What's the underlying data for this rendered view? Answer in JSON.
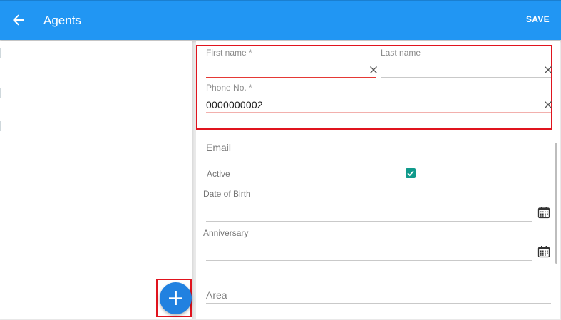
{
  "appbar": {
    "title": "Agents",
    "save_label": "SAVE",
    "colors": {
      "background": "#2196f3",
      "text": "#ffffff"
    },
    "back_icon": "arrow-back-icon"
  },
  "form": {
    "first_name": {
      "label": "First name *",
      "value": ""
    },
    "last_name": {
      "label": "Last name",
      "value": ""
    },
    "phone": {
      "label": "Phone No. *",
      "value": "0000000002"
    },
    "email": {
      "placeholder": "Email"
    },
    "active": {
      "label": "Active",
      "checked": true
    },
    "dob": {
      "label": "Date of Birth",
      "value": ""
    },
    "anniversary": {
      "label": "Anniversary",
      "value": ""
    },
    "area": {
      "placeholder": "Area"
    }
  },
  "fab": {
    "icon": "plus-icon",
    "color": "#2181e0"
  },
  "highlight_color": "#e0141e",
  "checkbox_color": "#109a8b"
}
